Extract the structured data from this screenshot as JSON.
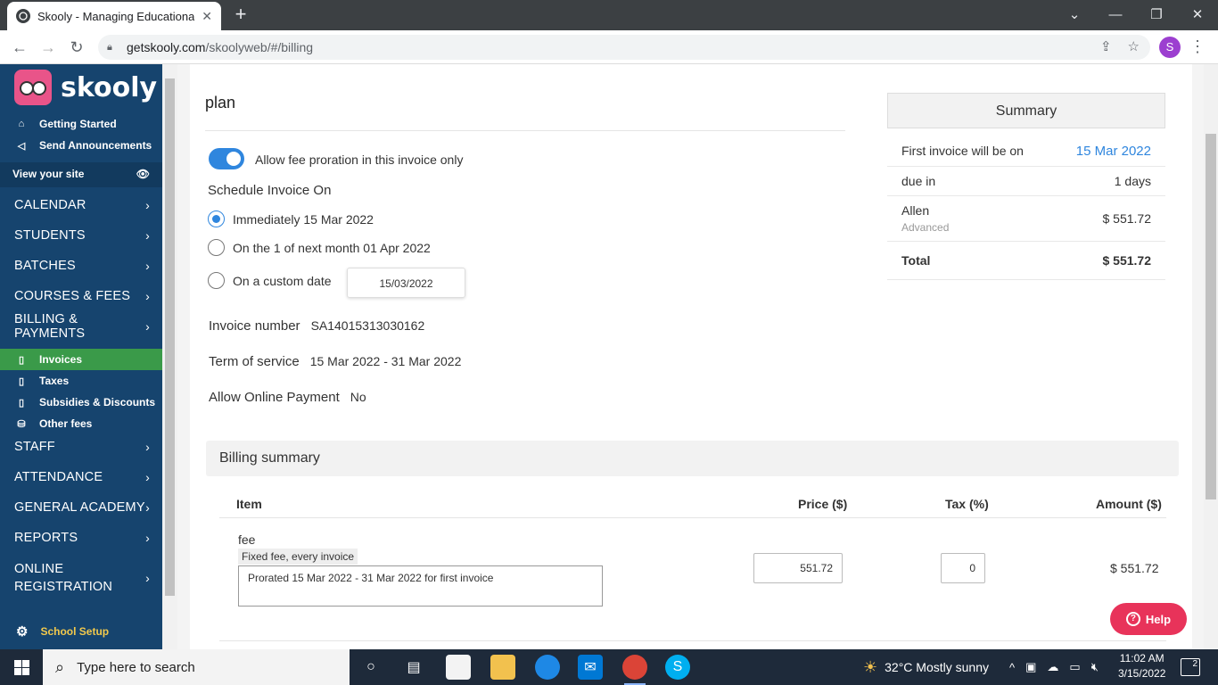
{
  "browser": {
    "tab_title": "Skooly - Managing Educational Jo",
    "url_domain": "getskooly.com",
    "url_path": "/skoolyweb/#/billing",
    "profile_initial": "S"
  },
  "sidebar": {
    "logo_text": "skooly",
    "quick_links": [
      {
        "label": "Getting Started",
        "icon": "home-icon"
      },
      {
        "label": "Send Announcements",
        "icon": "megaphone-icon"
      }
    ],
    "view_site": "View your site",
    "sections": [
      {
        "label": "CALENDAR"
      },
      {
        "label": "STUDENTS"
      },
      {
        "label": "BATCHES"
      },
      {
        "label": "COURSES & FEES"
      },
      {
        "label": "BILLING & PAYMENTS"
      }
    ],
    "billing_items": [
      {
        "label": "Invoices",
        "active": true
      },
      {
        "label": "Taxes"
      },
      {
        "label": "Subsidies & Discounts"
      },
      {
        "label": "Other fees"
      }
    ],
    "sections2": [
      {
        "label": "STAFF"
      },
      {
        "label": "ATTENDANCE"
      },
      {
        "label": "GENERAL ACADEMY"
      },
      {
        "label": "REPORTS"
      },
      {
        "label": "ONLINE REGISTRATION"
      }
    ],
    "school_setup": "School Setup",
    "active_color": "#3a9a49",
    "bg_color": "#16446e"
  },
  "main": {
    "plan_title": "plan",
    "proration_label": "Allow fee proration in this invoice only",
    "proration_on": true,
    "schedule_title": "Schedule Invoice On",
    "schedule_options": [
      {
        "label": "Immediately 15 Mar 2022",
        "selected": true
      },
      {
        "label": "On the 1 of next month 01 Apr 2022",
        "selected": false
      },
      {
        "label": "On a custom date",
        "selected": false
      }
    ],
    "custom_date": "15/03/2022",
    "invoice_number_label": "Invoice number",
    "invoice_number": "SA14015313030162",
    "term_label": "Term of service",
    "term_value": "15 Mar 2022 - 31 Mar 2022",
    "online_payment_label": "Allow Online Payment",
    "online_payment_value": "No"
  },
  "summary": {
    "title": "Summary",
    "first_invoice_label": "First invoice will be on",
    "first_invoice_date": "15 Mar 2022",
    "due_label": "due in",
    "due_value": "1 days",
    "student_name": "Allen",
    "student_plan": "Advanced",
    "student_amount": "$ 551.72",
    "total_label": "Total",
    "total_value": "$ 551.72"
  },
  "billing": {
    "title": "Billing summary",
    "headers": {
      "item": "Item",
      "price": "Price ($)",
      "tax": "Tax (%)",
      "amount": "Amount ($)"
    },
    "row": {
      "name": "fee",
      "tag": "Fixed fee, every invoice",
      "description": "Prorated 15 Mar 2022 - 31 Mar 2022 for first invoice",
      "price": "551.72",
      "tax": "0",
      "amount": "$ 551.72"
    }
  },
  "help_label": "Help",
  "taskbar": {
    "search_placeholder": "Type here to search",
    "weather": "32°C  Mostly sunny",
    "time": "11:02 AM",
    "date": "3/15/2022",
    "notifications": "2"
  }
}
